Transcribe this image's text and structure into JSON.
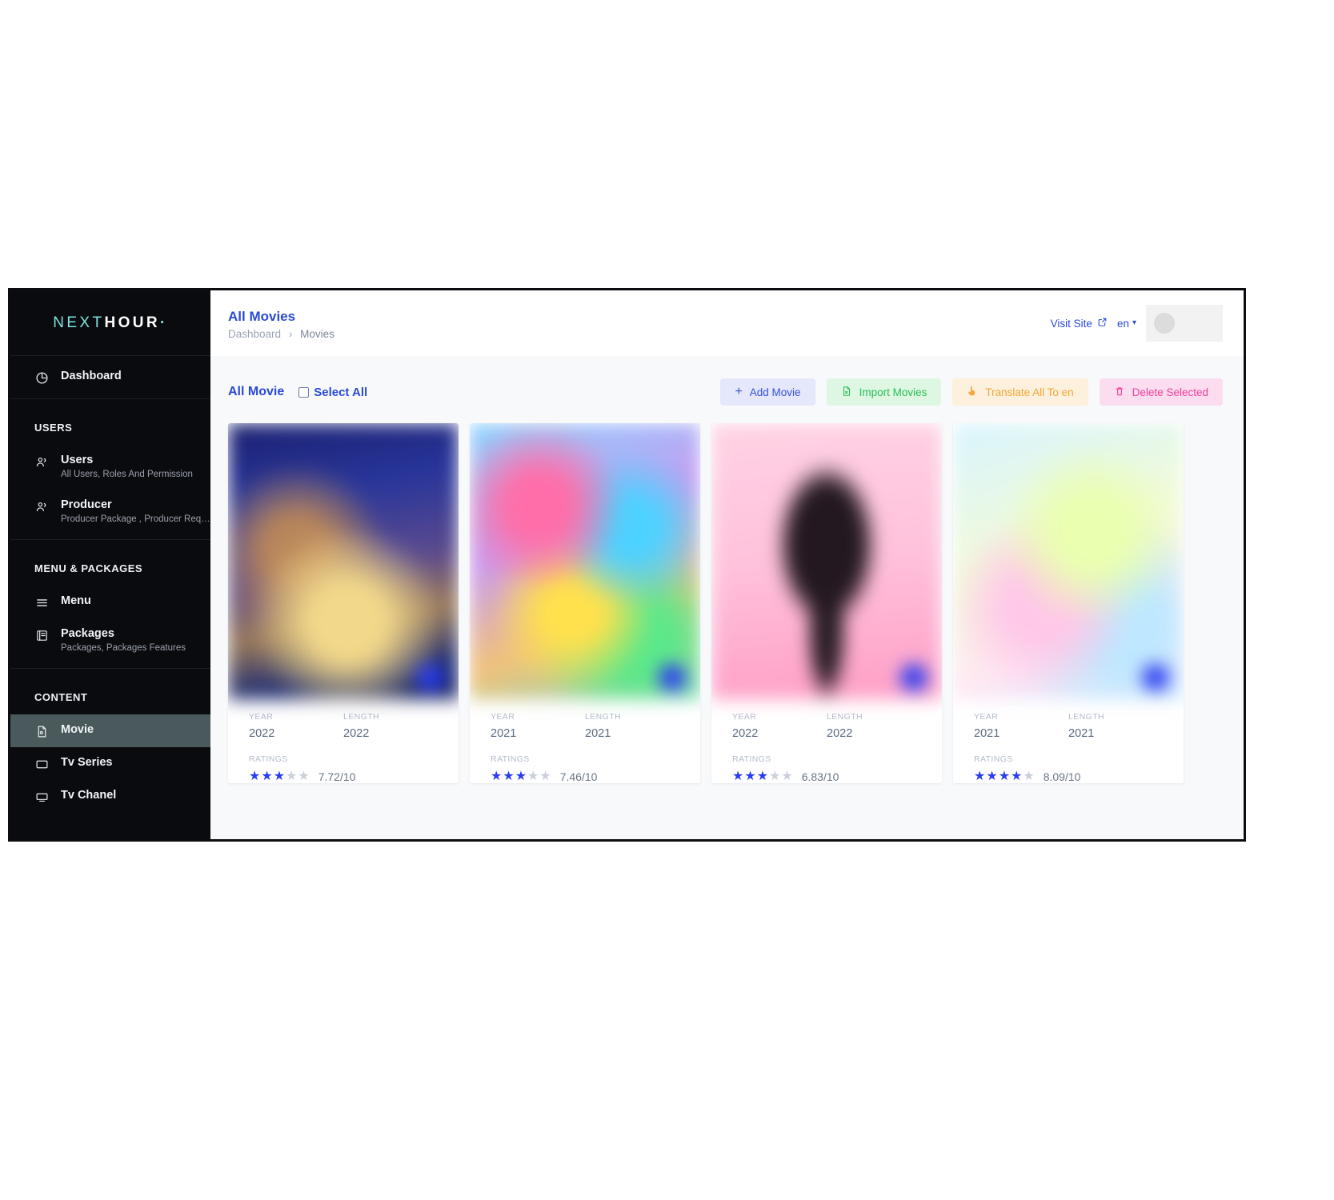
{
  "brand": {
    "part1": "NEXT",
    "part2": "HOUR",
    "dot": "·"
  },
  "sidebar": {
    "dashboard": {
      "label": "Dashboard",
      "icon": "clock-pie-icon"
    },
    "groups": [
      {
        "title": "USERS"
      },
      {
        "title": "MENU & PACKAGES"
      },
      {
        "title": "CONTENT"
      }
    ],
    "items": [
      {
        "label": "Users",
        "sub": "All Users, Roles And Permission",
        "icon": "users-icon"
      },
      {
        "label": "Producer",
        "sub": "Producer Package , Producer Requ...",
        "icon": "users-icon"
      },
      {
        "label": "Menu",
        "sub": "",
        "icon": "hamburger-icon"
      },
      {
        "label": "Packages",
        "sub": "Packages, Packages Features",
        "icon": "package-book-icon"
      },
      {
        "label": "Movie",
        "sub": "",
        "icon": "movie-file-icon"
      },
      {
        "label": "Tv Series",
        "sub": "",
        "icon": "tv-icon"
      },
      {
        "label": "Tv Chanel",
        "sub": "",
        "icon": "monitor-icon"
      }
    ]
  },
  "header": {
    "title": "All Movies",
    "breadcrumb": {
      "root": "Dashboard",
      "separator": "›",
      "current": "Movies"
    },
    "visit_site": "Visit Site",
    "language": "en"
  },
  "toolbar": {
    "section_title": "All Movie",
    "select_all_label": "Select All",
    "select_all_checked": false,
    "buttons": [
      {
        "label": "Add Movie",
        "icon": "plus-icon",
        "color": "#3552d8",
        "bg": "#e5e7fb"
      },
      {
        "label": "Import Movies",
        "icon": "excel-file-icon",
        "color": "#2bbd55",
        "bg": "#ddf7e3"
      },
      {
        "label": "Translate All To en",
        "icon": "translate-hand-icon",
        "color": "#f2a63b",
        "bg": "#fdf0dc"
      },
      {
        "label": "Delete Selected",
        "icon": "trash-icon",
        "color": "#f2409c",
        "bg": "#fcdcef"
      }
    ]
  },
  "card_field_labels": {
    "year": "YEAR",
    "length": "LENGTH",
    "ratings": "RATINGS"
  },
  "movies": [
    {
      "year": "2022",
      "length": "2022",
      "rating": "7.72/10",
      "stars_filled": 3
    },
    {
      "year": "2021",
      "length": "2021",
      "rating": "7.46/10",
      "stars_filled": 3
    },
    {
      "year": "2022",
      "length": "2022",
      "rating": "6.83/10",
      "stars_filled": 3
    },
    {
      "year": "2021",
      "length": "2021",
      "rating": "8.09/10",
      "stars_filled": 4
    }
  ],
  "theme": {
    "accent_blue": "#2b4ad6",
    "star_blue": "#2b3bf0",
    "sidebar_bg": "#0a0b0e",
    "sidebar_active": "#4a5a5c",
    "content_bg": "#f7f9fb"
  }
}
